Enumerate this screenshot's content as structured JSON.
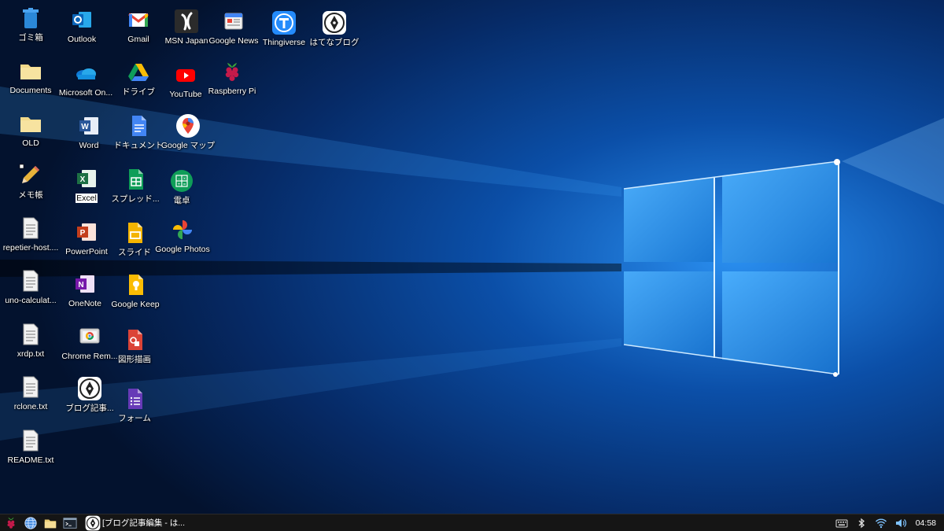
{
  "desktop": {
    "icons": [
      {
        "label": "ゴミ箱",
        "icon": "trash-icon"
      },
      {
        "label": "Documents",
        "icon": "folder-icon"
      },
      {
        "label": "OLD",
        "icon": "folder-icon"
      },
      {
        "label": "メモ帳",
        "icon": "pencil-icon"
      },
      {
        "label": "repetier-host....",
        "icon": "text-file-icon"
      },
      {
        "label": "uno-calculat...",
        "icon": "text-file-icon"
      },
      {
        "label": "xrdp.txt",
        "icon": "text-file-icon"
      },
      {
        "label": "rclone.txt",
        "icon": "text-file-icon"
      },
      {
        "label": "README.txt",
        "icon": "text-file-icon"
      },
      {
        "label": "Outlook",
        "icon": "outlook-icon"
      },
      {
        "label": "Microsoft On...",
        "icon": "onedrive-icon"
      },
      {
        "label": "Word",
        "icon": "word-icon"
      },
      {
        "label": "Excel",
        "icon": "excel-icon"
      },
      {
        "label": "PowerPoint",
        "icon": "powerpoint-icon"
      },
      {
        "label": "OneNote",
        "icon": "onenote-icon"
      },
      {
        "label": "Chrome Rem...",
        "icon": "chrome-remote-icon"
      },
      {
        "label": "ブログ記事...",
        "icon": "hatena-blog-icon"
      },
      {
        "label": "Gmail",
        "icon": "gmail-icon"
      },
      {
        "label": "ドライブ",
        "icon": "google-drive-icon"
      },
      {
        "label": "ドキュメント",
        "icon": "google-docs-icon"
      },
      {
        "label": "スプレッド...",
        "icon": "google-sheets-icon"
      },
      {
        "label": "スライド",
        "icon": "google-slides-icon"
      },
      {
        "label": "Google Keep",
        "icon": "google-keep-icon"
      },
      {
        "label": "図形描画",
        "icon": "google-drawings-icon"
      },
      {
        "label": "フォーム",
        "icon": "google-forms-icon"
      },
      {
        "label": "MSN Japan",
        "icon": "msn-icon"
      },
      {
        "label": "YouTube",
        "icon": "youtube-icon"
      },
      {
        "label": "Google マップ",
        "icon": "google-maps-icon"
      },
      {
        "label": "電卓",
        "icon": "calculator-icon"
      },
      {
        "label": "Google Photos",
        "icon": "google-photos-icon"
      },
      {
        "label": "Google News",
        "icon": "google-news-icon"
      },
      {
        "label": "Raspberry Pi",
        "icon": "raspberry-pi-icon"
      },
      {
        "label": "Thingiverse",
        "icon": "thingiverse-icon"
      },
      {
        "label": "はてなブログ",
        "icon": "hatena-blog-icon"
      }
    ]
  },
  "taskbar": {
    "launchers": [
      {
        "icon": "raspberry-menu-icon"
      },
      {
        "icon": "web-browser-icon"
      },
      {
        "icon": "file-manager-icon"
      },
      {
        "icon": "terminal-icon"
      }
    ],
    "task": {
      "label": "[ブログ記事編集 - は...",
      "icon": "hatena-blog-icon"
    },
    "tray": [
      {
        "icon": "keyboard-icon"
      },
      {
        "icon": "bluetooth-icon"
      },
      {
        "icon": "wifi-icon"
      },
      {
        "icon": "volume-icon"
      }
    ],
    "clock": "04:58"
  },
  "colors": {
    "wallpaper_dark": "#041233",
    "wallpaper_glow": "#1e88e5",
    "taskbar": "#151515"
  }
}
